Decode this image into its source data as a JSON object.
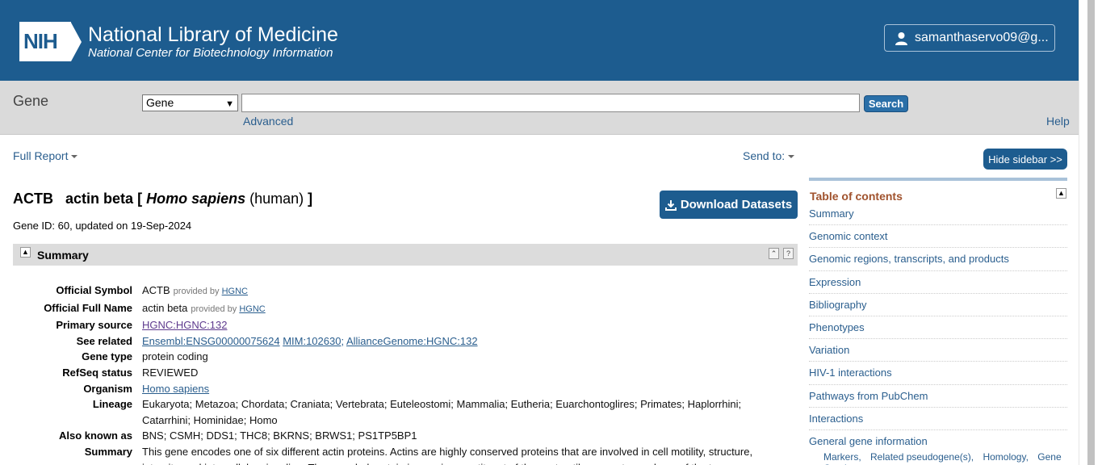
{
  "header": {
    "logo_text": "NIH",
    "title": "National Library of Medicine",
    "subtitle": "National Center for Biotechnology Information",
    "account": "samanthaservo09@g..."
  },
  "searchbar": {
    "db_name": "Gene",
    "db_select": "Gene",
    "search_value": "",
    "search_button": "Search",
    "advanced": "Advanced",
    "help": "Help"
  },
  "toolbar": {
    "full_report": "Full Report",
    "send_to": "Send to:",
    "hide_sidebar": "Hide sidebar >>"
  },
  "gene": {
    "symbol": "ACTB",
    "name": "actin beta",
    "bracket_open": "[",
    "organism": "Homo sapiens",
    "common": "(human)",
    "bracket_close": "]",
    "gene_id_line": "Gene ID: 60, updated on 19-Sep-2024",
    "download": "Download Datasets"
  },
  "summary": {
    "header": "Summary",
    "rows": [
      {
        "label": "Official Symbol",
        "value": "ACTB",
        "provided": "provided by",
        "provider": "HGNC"
      },
      {
        "label": "Official Full Name",
        "value": "actin beta",
        "provided": "provided by",
        "provider": "HGNC"
      },
      {
        "label": "Primary source",
        "link": "HGNC:HGNC:132"
      },
      {
        "label": "See related",
        "links": [
          "Ensembl:ENSG00000075624",
          "MIM:102630;",
          "AllianceGenome:HGNC:132"
        ]
      },
      {
        "label": "Gene type",
        "value": "protein coding"
      },
      {
        "label": "RefSeq status",
        "value": "REVIEWED"
      },
      {
        "label": "Organism",
        "link": "Homo sapiens"
      },
      {
        "label": "Lineage",
        "value": "Eukaryota; Metazoa; Chordata; Craniata; Vertebrata; Euteleostomi; Mammalia; Eutheria; Euarchontoglires; Primates; Haplorrhini; Catarrhini; Hominidae; Homo"
      },
      {
        "label": "Also known as",
        "value": "BNS; CSMH; DDS1; THC8; BKRNS; BRWS1; PS1TP5BP1"
      },
      {
        "label": "Summary",
        "value": "This gene encodes one of six different actin proteins. Actins are highly conserved proteins that are involved in cell motility, structure, integrity, and intercellular signaling. The encoded protein is a major constituent of the contractile apparatus and one of the two"
      }
    ]
  },
  "toc": {
    "title": "Table of contents",
    "items": [
      "Summary",
      "Genomic context",
      "Genomic regions, transcripts, and products",
      "Expression",
      "Bibliography",
      "Phenotypes",
      "Variation",
      "HIV-1 interactions",
      "Pathways from PubChem",
      "Interactions",
      "General gene information"
    ],
    "sub_items": [
      "Markers,",
      "Related pseudogene(s),",
      "Homology,",
      "Gene Ontology"
    ]
  }
}
